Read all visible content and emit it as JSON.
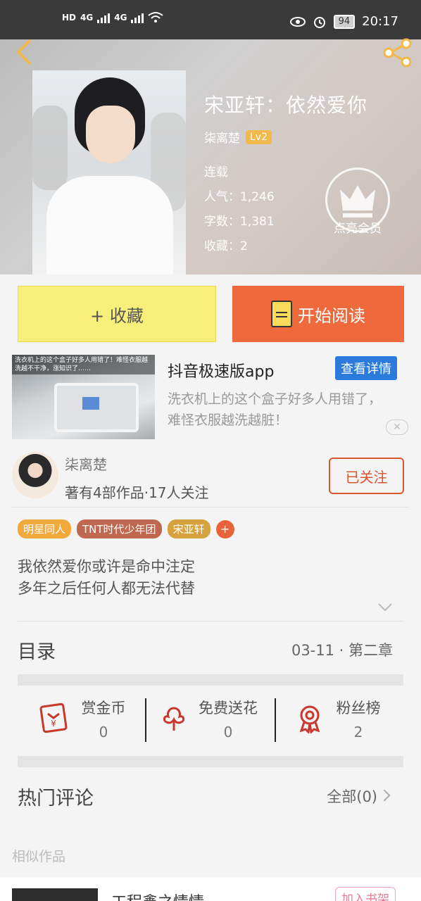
{
  "status_bar": {
    "hd1": "HD",
    "hd2": "HD",
    "net1": "4G",
    "net2": "4G",
    "battery": "94",
    "time": "20:17"
  },
  "book": {
    "title": "宋亚轩：依然爱你",
    "author": "柒离楚",
    "level": "Lv2",
    "status": "连载",
    "popularity": "人气：1,246",
    "word_count": "字数：1,381",
    "favorites": "收藏：2",
    "vip_label": "点亮会员"
  },
  "actions": {
    "collect": "+ 收藏",
    "read": "开始阅读"
  },
  "ad": {
    "thumb_caption": "洗衣机上的这个盒子好多人用错了！难怪衣服越洗越不干净，涨知识了……",
    "title": "抖音极速版app",
    "detail_button": "查看详情",
    "description": "洗衣机上的这个盒子好多人用错了，难怪衣服越洗越脏！",
    "close": "✕"
  },
  "author_card": {
    "name": "柒离楚",
    "meta": "著有4部作品·17人关注",
    "follow_label": "已关注"
  },
  "tags": [
    {
      "label": "明星同人",
      "color": "#f2a93b"
    },
    {
      "label": "TNT时代少年团",
      "color": "#c0684f"
    },
    {
      "label": "宋亚轩",
      "color": "#d6a23d"
    }
  ],
  "tag_add": "+",
  "intro": {
    "line1": "我依然爱你或许是命中注定",
    "line2": "多年之后任何人都无法代替"
  },
  "catalog": {
    "title": "目录",
    "latest": "03-11 · 第二章"
  },
  "stats": [
    {
      "label": "赏金币",
      "value": "0",
      "icon": "red-envelope-icon"
    },
    {
      "label": "免费送花",
      "value": "0",
      "icon": "flower-icon"
    },
    {
      "label": "粉丝榜",
      "value": "2",
      "icon": "medal-icon"
    }
  ],
  "comments": {
    "title": "热门评论",
    "all": "全部(0)"
  },
  "similar": {
    "title": "相似作品",
    "item_title": "工程鑫之情情",
    "add_label": "加入书架"
  }
}
